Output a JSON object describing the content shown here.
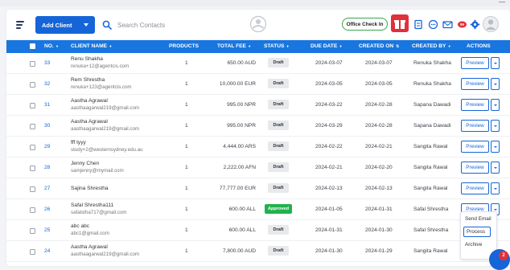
{
  "header": {
    "add_client_label": "Add Client",
    "search_placeholder": "Search Contacts",
    "checkin_label": "Office Check In"
  },
  "table": {
    "columns": [
      "NO.",
      "CLIENT NAME",
      "PRODUCTS",
      "TOTAL FEE",
      "STATUS",
      "DUE DATE",
      "CREATED ON",
      "CREATED BY",
      "ACTIONS"
    ],
    "rows": [
      {
        "no": "33",
        "name": "Renu Shakha",
        "email": "renuka+12@agentcis.com",
        "products": "1",
        "fee": "650.00 AUD",
        "status": "Draft",
        "due": "2024-03-07",
        "created": "2024-03-07",
        "by": "Renuka Shakha",
        "action": "Preview"
      },
      {
        "no": "32",
        "name": "Rem Shrestha",
        "email": "renuka+123@agentcis.com",
        "products": "1",
        "fee": "10,000.00 EUR",
        "status": "Draft",
        "due": "2024-03-05",
        "created": "2024-03-05",
        "by": "Renuka Shakha",
        "action": "Preview"
      },
      {
        "no": "31",
        "name": "Aastha Agrawal",
        "email": "aasthaagarwal219@gmail.com",
        "products": "1",
        "fee": "995.00 NPR",
        "status": "Draft",
        "due": "2024-03-22",
        "created": "2024-02-28",
        "by": "Sapana Dawadi",
        "action": "Preview"
      },
      {
        "no": "30",
        "name": "Aastha Agrawal",
        "email": "aasthaagarwal219@gmail.com",
        "products": "1",
        "fee": "995.00 NPR",
        "status": "Draft",
        "due": "2024-03-29",
        "created": "2024-02-28",
        "by": "Sapana Dawadi",
        "action": "Preview"
      },
      {
        "no": "29",
        "name": "fff tyyy",
        "email": "study+2@westernsydney.edu.au",
        "products": "1",
        "fee": "4,444.00 ARS",
        "status": "Draft",
        "due": "2024-02-22",
        "created": "2024-02-21",
        "by": "Sangita Rawal",
        "action": "Preview"
      },
      {
        "no": "28",
        "name": "Jenny Chen",
        "email": "samjenny@mymail.com",
        "products": "1",
        "fee": "2,222.00 AFN",
        "status": "Draft",
        "due": "2024-02-21",
        "created": "2024-02-20",
        "by": "Sangita Rawal",
        "action": "Preview"
      },
      {
        "no": "27",
        "name": "Sajina Shrestha",
        "email": "",
        "products": "1",
        "fee": "77,777.00 EUR",
        "status": "Draft",
        "due": "2024-02-13",
        "created": "2024-02-13",
        "by": "Sangita Rawal",
        "action": "Preview"
      },
      {
        "no": "26",
        "name": "Safal Shrestha111",
        "email": "safalstha717@gmail.com",
        "products": "1",
        "fee": "600.00 ALL",
        "status": "Approved",
        "due": "2024-01-05",
        "created": "2024-01-31",
        "by": "Safal Shrestha",
        "action": "Preview"
      },
      {
        "no": "25",
        "name": "abc abc",
        "email": "abc1@gmail.com",
        "products": "1",
        "fee": "600.00 ALL",
        "status": "Draft",
        "due": "2024-01-31",
        "created": "2024-01-30",
        "by": "Safal Shrestha",
        "action": ""
      },
      {
        "no": "24",
        "name": "Aastha Agrawal",
        "email": "aasthaagarwal219@gmail.com",
        "products": "1",
        "fee": "7,800.00 AUD",
        "status": "Draft",
        "due": "2024-01-30",
        "created": "2024-01-29",
        "by": "Sangita Rawal",
        "action": ""
      }
    ]
  },
  "action_menu": {
    "items": [
      "Send Email",
      "Process",
      "Archive"
    ],
    "selected": "Process"
  },
  "notification_count": "2",
  "colors": {
    "primary": "#1565d8",
    "header_row": "#1976e0",
    "approved": "#22b24c",
    "alert": "#e0303a",
    "checkin_border": "#3aa64a"
  },
  "icons": [
    "menu-icon",
    "search-icon",
    "gift-icon",
    "document-icon",
    "chat-icon",
    "mail-icon",
    "bell-icon",
    "settings-icon",
    "user-avatar-icon"
  ]
}
